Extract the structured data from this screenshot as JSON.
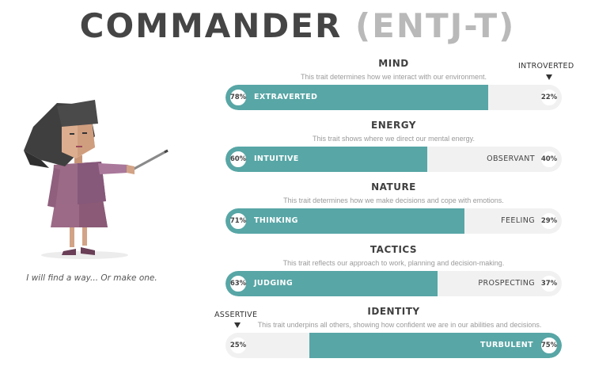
{
  "title": {
    "name": "COMMANDER",
    "code": "(ENTJ-T)"
  },
  "character": {
    "quote": "I will find a way... Or make one."
  },
  "traits": [
    {
      "heading": "MIND",
      "description": "This trait determines how we interact with our environment.",
      "left_label": "EXTRAVERTED",
      "left_percent": "78%",
      "right_label": "",
      "right_percent": "22%",
      "dominant": "left",
      "fill_fraction": 0.78
    },
    {
      "heading": "ENERGY",
      "description": "This trait shows where we direct our mental energy.",
      "left_label": "INTUITIVE",
      "left_percent": "60%",
      "right_label": "OBSERVANT",
      "right_percent": "40%",
      "dominant": "left",
      "fill_fraction": 0.6
    },
    {
      "heading": "NATURE",
      "description": "This trait determines how we make decisions and cope with emotions.",
      "left_label": "THINKING",
      "left_percent": "71%",
      "right_label": "FEELING",
      "right_percent": "29%",
      "dominant": "left",
      "fill_fraction": 0.71
    },
    {
      "heading": "TACTICS",
      "description": "This trait reflects our approach to work, planning and decision-making.",
      "left_label": "JUDGING",
      "left_percent": "63%",
      "right_label": "PROSPECTING",
      "right_percent": "37%",
      "dominant": "left",
      "fill_fraction": 0.63
    },
    {
      "heading": "IDENTITY",
      "description": "This trait underpins all others, showing how confident we are in our abilities and decisions.",
      "left_label": "",
      "left_percent": "25%",
      "right_label": "TURBULENT",
      "right_percent": "75%",
      "dominant": "right",
      "fill_fraction": 0.75
    }
  ],
  "tags": {
    "introverted": "INTROVERTED",
    "assertive": "ASSERTIVE"
  },
  "colors": {
    "accent": "#58a6a6",
    "track": "#f1f1f1",
    "title_dark": "#454545",
    "title_light": "#b9b9b9"
  }
}
